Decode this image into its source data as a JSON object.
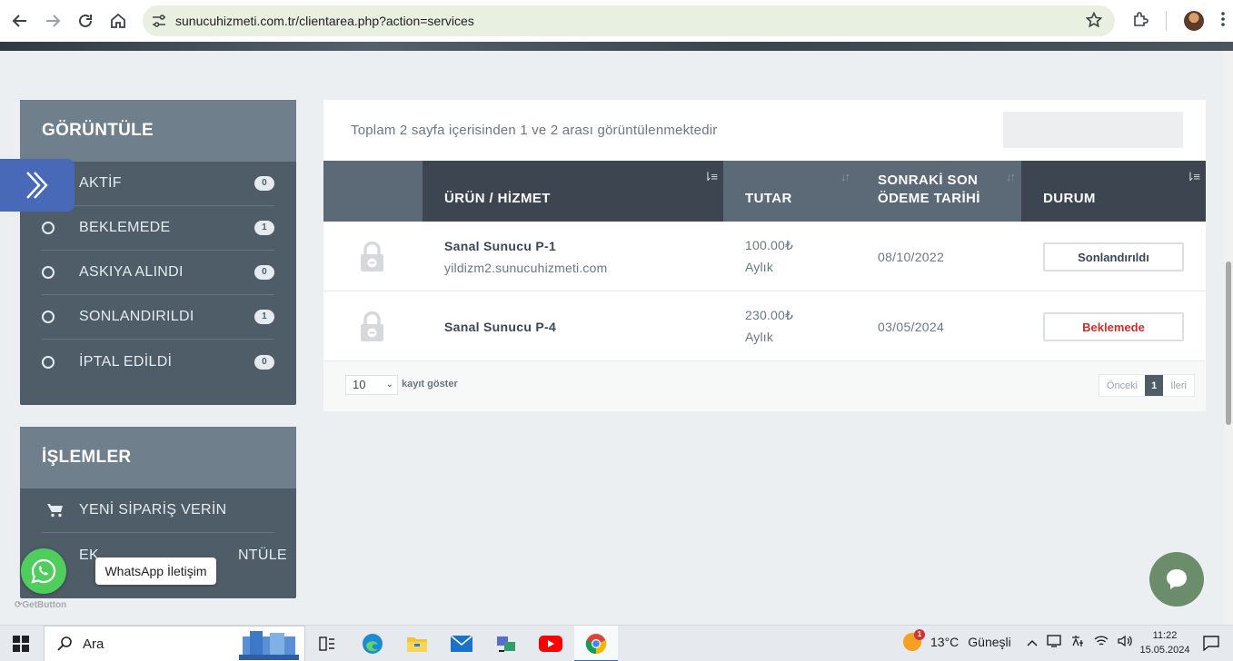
{
  "browser": {
    "url": "sunucuhizmeti.com.tr/clientarea.php?action=services"
  },
  "sidebar": {
    "view_panel": {
      "title": "GÖRÜNTÜLE",
      "filters": [
        {
          "label": "AKTİF",
          "count": "0"
        },
        {
          "label": "BEKLEMEDE",
          "count": "1"
        },
        {
          "label": "ASKIYA ALINDI",
          "count": "0"
        },
        {
          "label": "SONLANDIRILDI",
          "count": "1"
        },
        {
          "label": "İPTAL EDİLDİ",
          "count": "0"
        }
      ]
    },
    "actions_panel": {
      "title": "İŞLEMLER",
      "items": [
        {
          "label": "YENİ SİPARİŞ VERİN",
          "icon": "cart-icon"
        },
        {
          "label": "EK ... GÖRÜNTÜLE",
          "label_visible_prefix": "EK",
          "label_visible_suffix": "NTÜLE"
        }
      ]
    }
  },
  "main": {
    "info_text": "Toplam 2 sayfa içerisinden 1 ve 2 arası görüntülenmektedir",
    "table": {
      "columns": [
        "ÜRÜN / HİZMET",
        "TUTAR",
        "SONRAKİ SON ÖDEME TARİHİ",
        "DURUM"
      ],
      "rows": [
        {
          "product": "Sanal Sunucu P-1",
          "domain": "yildizm2.sunucuhizmeti.com",
          "amount": "100.00₺",
          "cycle": "Aylık",
          "due_date": "08/10/2022",
          "status": "Sonlandırıldı",
          "status_color": "#3b4753"
        },
        {
          "product": "Sanal Sunucu P-4",
          "domain": "",
          "amount": "230.00₺",
          "cycle": "Aylık",
          "due_date": "03/05/2024",
          "status": "Beklemede",
          "status_color": "#c9302c"
        }
      ]
    },
    "footer": {
      "page_length": "10",
      "page_length_label": "kayıt göster",
      "prev": "Önceki",
      "current_page": "1",
      "next": "İleri"
    }
  },
  "widgets": {
    "whatsapp_tooltip": "WhatsApp İletişim",
    "getbutton_label": "GetButton"
  },
  "taskbar": {
    "search_label": "Ara",
    "weather_temp": "13°C",
    "weather_desc": "Güneşli",
    "weather_badge": "1",
    "time": "11:22",
    "date": "15.05.2024"
  },
  "colors": {
    "sidebar_bg": "#4e5d68",
    "sidebar_head": "#6f7f8c",
    "table_head_dark": "#3d4650",
    "table_head_mid": "#5b6a76",
    "whatsapp": "#4fce5d",
    "chat": "#6c8d6c",
    "toggle": "#4868b8"
  }
}
